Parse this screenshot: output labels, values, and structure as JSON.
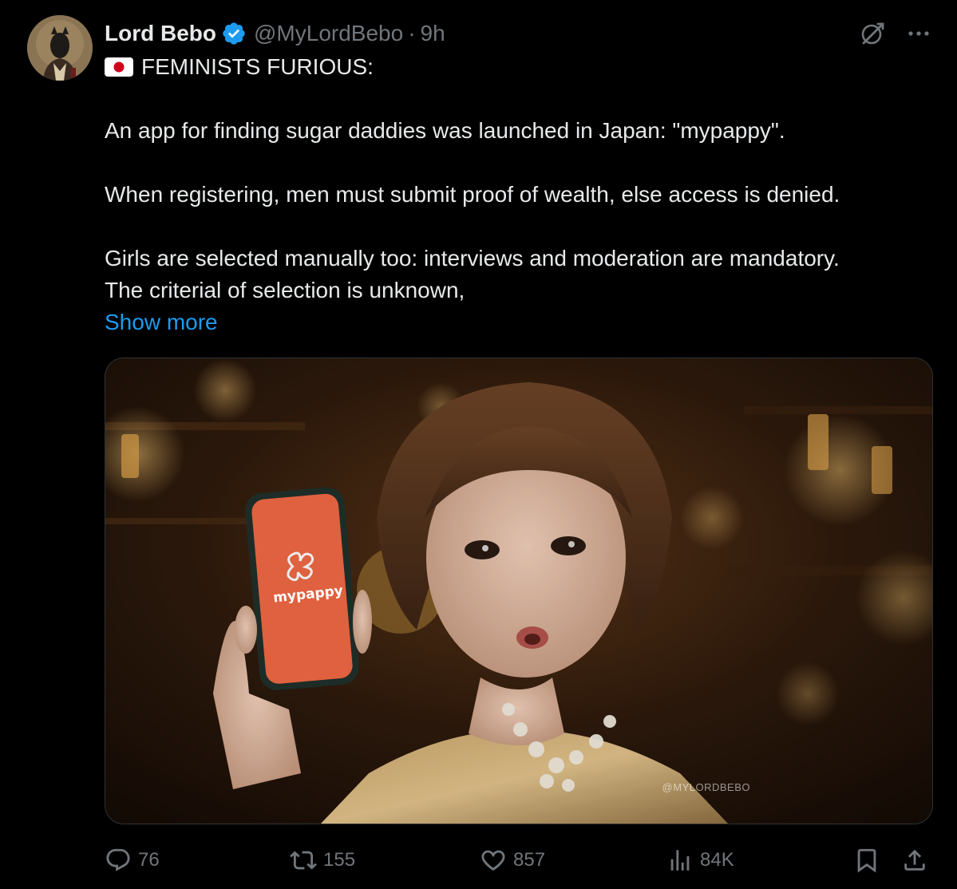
{
  "author": {
    "display_name": "Lord Bebo",
    "handle": "@MyLordBebo",
    "separator": "·",
    "time": "9h"
  },
  "icons": {
    "verified": "verified-badge-icon",
    "grok": "grok-icon",
    "more": "more-icon"
  },
  "tweet": {
    "headline": "FEMINISTS FURIOUS:",
    "paragraphs": [
      "An app for finding sugar daddies was launched in Japan: \"mypappy\".",
      "When registering, men must submit proof of wealth, else access is denied.",
      "Girls are selected manually too: interviews and moderation are mandatory.",
      "The criterial of selection is unknown,"
    ],
    "show_more": "Show more"
  },
  "media": {
    "phone_app_name": "mypappy",
    "watermark": "@MYLORDBEBO"
  },
  "actions": {
    "replies": "76",
    "retweets": "155",
    "likes": "857",
    "views": "84K"
  },
  "colors": {
    "background": "#000000",
    "text": "#e7e9ea",
    "muted": "#71767b",
    "link": "#1d9bf0",
    "verified": "#1d9bf0",
    "app_orange": "#f26a45"
  }
}
